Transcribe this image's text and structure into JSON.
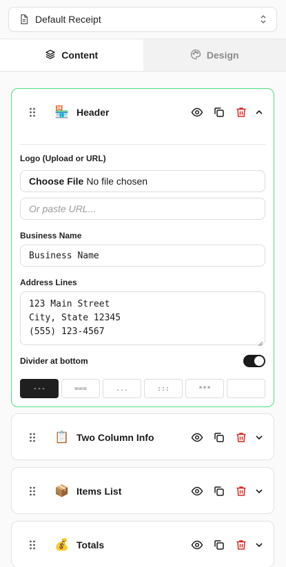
{
  "template_select": {
    "value": "Default Receipt"
  },
  "tabs": [
    {
      "label": "Content",
      "icon": "layers-icon",
      "active": true
    },
    {
      "label": "Design",
      "icon": "palette-icon",
      "active": false
    }
  ],
  "sections": [
    {
      "title": "Header",
      "emoji": "🏪",
      "expanded": true
    },
    {
      "title": "Two Column Info",
      "emoji": "📋",
      "expanded": false
    },
    {
      "title": "Items List",
      "emoji": "📦",
      "expanded": false
    },
    {
      "title": "Totals",
      "emoji": "💰",
      "expanded": false
    }
  ],
  "header_form": {
    "logo_label": "Logo (Upload or URL)",
    "file_button": "Choose File",
    "file_status": "No file chosen",
    "url_placeholder": "Or paste URL...",
    "business_name_label": "Business Name",
    "business_name_value": "Business Name",
    "address_label": "Address Lines",
    "address_lines": [
      "123 Main Street",
      "City, State 12345",
      "(555) 123-4567"
    ],
    "divider_label": "Divider at bottom",
    "divider_on": true,
    "divider_styles": [
      "---",
      "===",
      "...",
      ":::",
      "***",
      ""
    ],
    "selected_divider_style": "---"
  },
  "colors": {
    "accent_border": "#4ade80",
    "delete": "#dc2626",
    "toggle_on": "#1a1a1a"
  }
}
